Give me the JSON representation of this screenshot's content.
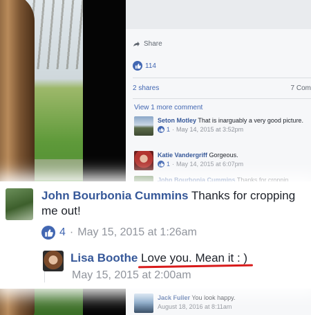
{
  "post": {
    "share_label": "Share",
    "likes_count": "114",
    "shares_label": "2 shares",
    "comments_label": "7 Com",
    "view_more_label": "View 1 more comment"
  },
  "comments": [
    {
      "name": "Seton Motley",
      "text": "That is inarguably a very good picture.",
      "likes": "1",
      "time": "May 14, 2015 at 3:52pm"
    },
    {
      "name": "Katie Vandergriff",
      "text": "Gorgeous.",
      "likes": "1",
      "time": "May 14, 2015 at 6:07pm"
    },
    {
      "name": "John Bourbonia Cummins",
      "text": "Thanks for croppin"
    },
    {
      "name": "Jack Fuller",
      "text": "You look happy.",
      "time": "August 18, 2016 at 8:11am"
    }
  ],
  "zoom": {
    "name": "John Bourbonia Cummins",
    "text": "Thanks for cropping me out!",
    "likes": "4",
    "sep": "·",
    "time": "May 15, 2015 at 1:26am",
    "reply_name": "Lisa Boothe",
    "reply_text": "Love you. Mean it : )",
    "reply_time": "May 15, 2015 at 2:00am"
  },
  "colors": {
    "link": "#365899",
    "like_blue": "#4267b2",
    "underline_red": "#d81a1a"
  },
  "icons": [
    "share-icon",
    "like-icon"
  ]
}
